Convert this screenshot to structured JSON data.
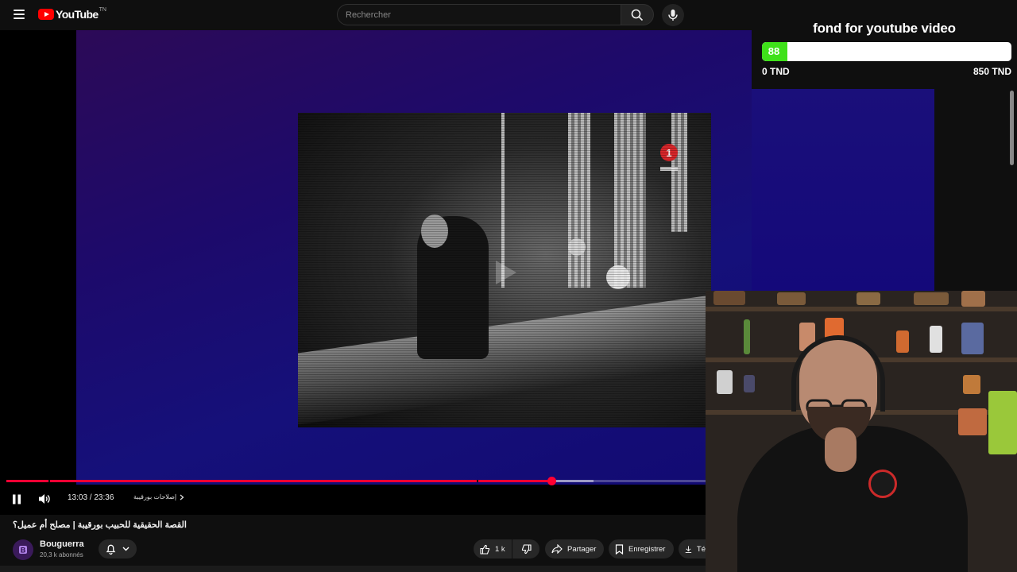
{
  "header": {
    "logo_text": "YouTube",
    "logo_region": "TN",
    "search_placeholder": "Rechercher"
  },
  "widget": {
    "title": "fond for youtube video",
    "current_value": 88,
    "min_label": "0 TND",
    "max_label": "850 TND",
    "fill_fraction": 0.103,
    "fill_color": "#3fe11a"
  },
  "player": {
    "time_display": "13:03 / 23:36",
    "chapter_label": "إصلاحات بورقيبة",
    "played_fraction": 0.78,
    "buffered_fraction": 0.84,
    "accent_color": "#ff0033"
  },
  "video_info": {
    "title": "القصة الحقيقية للحبيب بورقيبة | مصلح أم عميل؟",
    "channel_name": "Bouguerra",
    "subscribers": "20,3 k abonnés",
    "likes": "1 k",
    "share_label": "Partager",
    "save_label": "Enregistrer",
    "download_label": "Té"
  },
  "icons": {
    "menu": "hamburger-icon",
    "search": "search-icon",
    "mic": "microphone-icon",
    "pause": "pause-icon",
    "volume": "volume-icon",
    "bell": "bell-icon",
    "like": "thumbs-up-icon",
    "dislike": "thumbs-down-icon",
    "share": "share-icon",
    "save": "bookmark-icon",
    "download": "download-icon"
  }
}
